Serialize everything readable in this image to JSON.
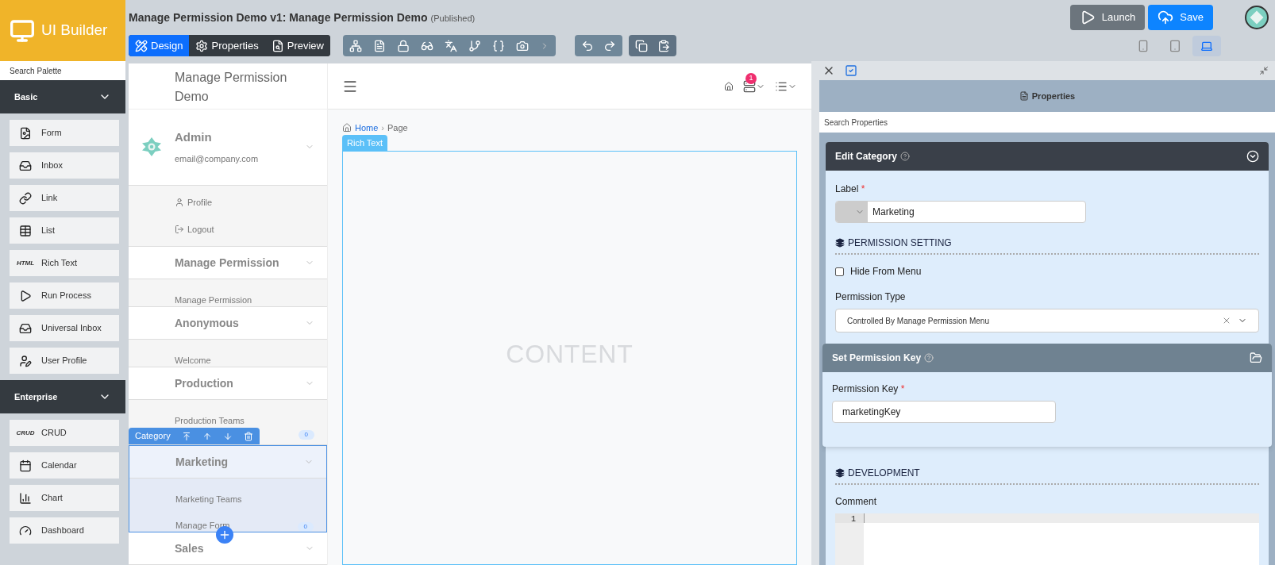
{
  "app": {
    "name": "UI Builder"
  },
  "header": {
    "title": "Manage Permission Demo v1: Manage Permission Demo",
    "status": "(Published)"
  },
  "mode_tabs": [
    {
      "label": "Design",
      "selected": true
    },
    {
      "label": "Properties",
      "selected": false
    },
    {
      "label": "Preview",
      "selected": false
    }
  ],
  "actions": [
    {
      "label": "Launch",
      "kind": "secondary"
    },
    {
      "label": "Save",
      "kind": "primary"
    }
  ],
  "view_modes": [
    {
      "kind": "mobile",
      "selected": false
    },
    {
      "kind": "tablet",
      "selected": false
    },
    {
      "kind": "desktop",
      "selected": true
    }
  ],
  "palette": {
    "placeholder": "Search Palette",
    "groups": [
      {
        "title": "Basic",
        "expanded": true,
        "items": [
          {
            "label": "Form",
            "kind": "icon"
          },
          {
            "label": "Inbox",
            "kind": "icon"
          },
          {
            "label": "Link",
            "kind": "icon"
          },
          {
            "label": "List",
            "kind": "icon"
          },
          {
            "label": "Rich Text",
            "kind": "text",
            "icon_text": "HTML"
          },
          {
            "label": "Run Process",
            "kind": "icon"
          },
          {
            "label": "Universal Inbox",
            "kind": "icon"
          },
          {
            "label": "User Profile",
            "kind": "icon"
          }
        ]
      },
      {
        "title": "Enterprise",
        "expanded": true,
        "items": [
          {
            "label": "CRUD",
            "kind": "text",
            "icon_text": "CRUD"
          },
          {
            "label": "Calendar",
            "kind": "icon"
          },
          {
            "label": "Chart",
            "kind": "icon"
          },
          {
            "label": "Dashboard",
            "kind": "icon"
          }
        ]
      }
    ]
  },
  "menu_preview": {
    "title": "Manage Permission Demo",
    "user": {
      "name": "Admin",
      "email": "email@company.com",
      "links": [
        "Profile",
        "Logout"
      ]
    },
    "categories": [
      {
        "label": "Manage Permission",
        "selected": false,
        "items": [
          {
            "label": "Manage Permission"
          }
        ]
      },
      {
        "label": "Anonymous",
        "selected": false,
        "items": [
          {
            "label": "Welcome"
          }
        ]
      },
      {
        "label": "Production",
        "selected": false,
        "items": [
          {
            "label": "Production Teams"
          },
          {
            "badge": "0"
          }
        ]
      },
      {
        "label": "Marketing",
        "selected": true,
        "items": [
          {
            "label": "Marketing Teams"
          },
          {
            "label": "Manage Form",
            "badge": "0"
          }
        ]
      },
      {
        "label": "Sales",
        "selected": false
      }
    ],
    "selection_tag": "Category"
  },
  "top_nav": {
    "notification_count": "1"
  },
  "breadcrumb": [
    "Home",
    "Page"
  ],
  "breadcrumb_separator": "›",
  "canvas": {
    "element_tag": "Rich Text",
    "placeholder": "CONTENT"
  },
  "properties": {
    "title": "Properties",
    "placeholder": "Search Properties",
    "section_title": "Edit Category",
    "label_field": {
      "label": "Label",
      "required_mark": "*",
      "value": "Marketing"
    },
    "permission_heading": "PERMISSION SETTING",
    "hide_from_menu": {
      "label": "Hide From Menu",
      "checked": false
    },
    "permission_type": {
      "label": "Permission Type",
      "value": "Controlled By Manage Permission Menu"
    },
    "permission_key_card": {
      "title": "Set Permission Key",
      "label": "Permission Key",
      "required_mark": "*",
      "value": "marketingKey"
    },
    "development_heading": "DEVELOPMENT",
    "comment": {
      "label": "Comment",
      "line_numbers": [
        "1"
      ]
    }
  }
}
